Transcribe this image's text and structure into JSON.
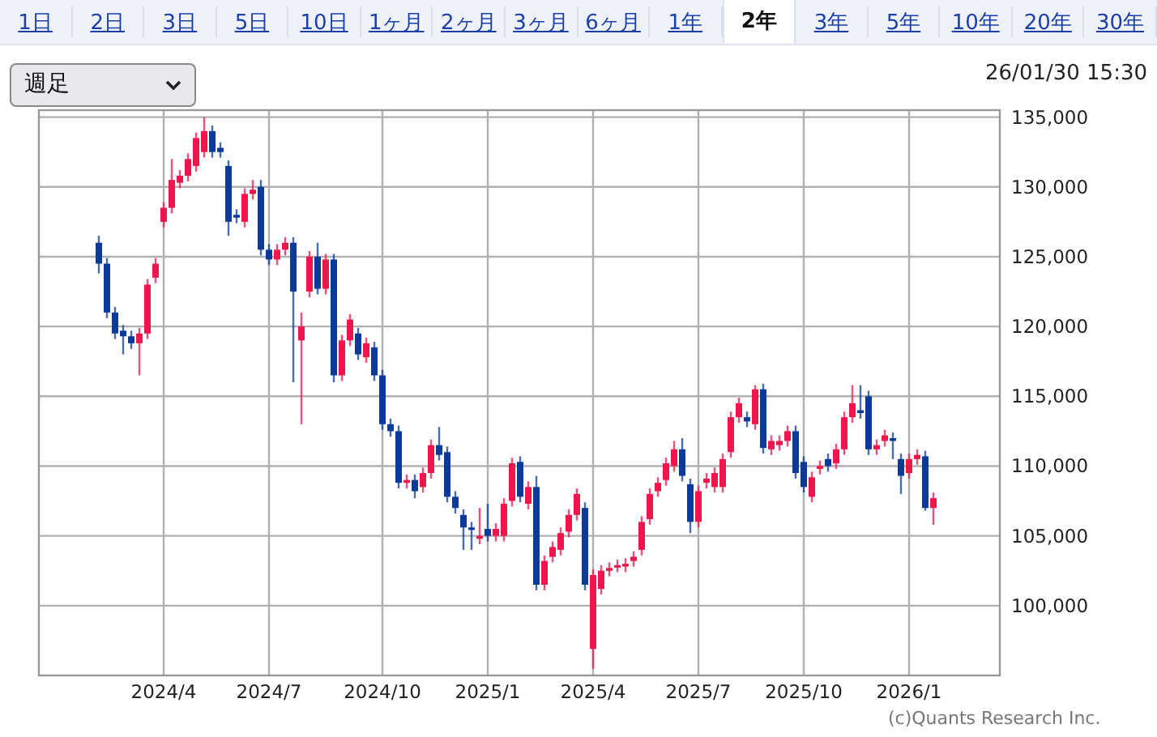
{
  "tabs": [
    {
      "label": "1日",
      "selected": false
    },
    {
      "label": "2日",
      "selected": false
    },
    {
      "label": "3日",
      "selected": false
    },
    {
      "label": "5日",
      "selected": false
    },
    {
      "label": "10日",
      "selected": false
    },
    {
      "label": "1ヶ月",
      "selected": false
    },
    {
      "label": "2ヶ月",
      "selected": false
    },
    {
      "label": "3ヶ月",
      "selected": false
    },
    {
      "label": "6ヶ月",
      "selected": false
    },
    {
      "label": "1年",
      "selected": false
    },
    {
      "label": "2年",
      "selected": true
    },
    {
      "label": "3年",
      "selected": false
    },
    {
      "label": "5年",
      "selected": false
    },
    {
      "label": "10年",
      "selected": false
    },
    {
      "label": "20年",
      "selected": false
    },
    {
      "label": "30年",
      "selected": false
    }
  ],
  "interval_select": {
    "value": "週足"
  },
  "timestamp": "26/01/30 15:30",
  "chart": {
    "chart_data": {
      "type": "candlestick",
      "grid": true,
      "ylim": [
        95000,
        135500
      ],
      "yticks": [
        {
          "value": 100000,
          "label": "100,000"
        },
        {
          "value": 105000,
          "label": "105,000"
        },
        {
          "value": 110000,
          "label": "110,000"
        },
        {
          "value": 115000,
          "label": "115,000"
        },
        {
          "value": 120000,
          "label": "120,000"
        },
        {
          "value": 125000,
          "label": "125,000"
        },
        {
          "value": 130000,
          "label": "130,000"
        },
        {
          "value": 135000,
          "label": "135,000"
        }
      ],
      "categories": [
        null,
        null,
        null,
        null,
        null,
        null,
        null,
        null,
        "2024/4",
        null,
        null,
        null,
        null,
        null,
        null,
        null,
        null,
        null,
        null,
        null,
        null,
        "2024/7",
        null,
        null,
        null,
        null,
        null,
        null,
        null,
        null,
        null,
        null,
        null,
        null,
        null,
        "2024/10",
        null,
        null,
        null,
        null,
        null,
        null,
        null,
        null,
        null,
        null,
        null,
        null,
        "2025/1",
        null,
        null,
        null,
        null,
        null,
        null,
        null,
        null,
        null,
        null,
        null,
        null,
        "2025/4",
        null,
        null,
        null,
        null,
        null,
        null,
        null,
        null,
        null,
        null,
        null,
        null,
        "2025/7",
        null,
        null,
        null,
        null,
        null,
        null,
        null,
        null,
        null,
        null,
        null,
        null,
        "2025/10",
        null,
        null,
        null,
        null,
        null,
        null,
        null,
        null,
        null,
        null,
        null,
        null,
        "2026/1",
        null,
        null,
        null
      ],
      "ohlc": [
        [
          126000,
          126500,
          123800,
          124500
        ],
        [
          124500,
          124900,
          120600,
          121000
        ],
        [
          121000,
          121400,
          119100,
          119500
        ],
        [
          119700,
          120100,
          118000,
          119300
        ],
        [
          119300,
          119700,
          118400,
          118800
        ],
        [
          118800,
          119900,
          116500,
          119500
        ],
        [
          119500,
          123400,
          119100,
          123000
        ],
        [
          123500,
          124900,
          123100,
          124500
        ],
        [
          127500,
          128900,
          127100,
          128500
        ],
        [
          128500,
          132000,
          128100,
          130500
        ],
        [
          130300,
          131200,
          129900,
          130800
        ],
        [
          130800,
          132400,
          130400,
          132000
        ],
        [
          131500,
          133900,
          131100,
          133500
        ],
        [
          132500,
          135000,
          132100,
          134000
        ],
        [
          134000,
          134400,
          132100,
          132500
        ],
        [
          132800,
          133200,
          132100,
          132500
        ],
        [
          131500,
          131900,
          126500,
          127500
        ],
        [
          128000,
          128400,
          127400,
          127800
        ],
        [
          127500,
          129900,
          127100,
          129500
        ],
        [
          129500,
          130500,
          129100,
          129800
        ],
        [
          130000,
          130500,
          125100,
          125500
        ],
        [
          125500,
          125900,
          124400,
          124800
        ],
        [
          124800,
          125900,
          124400,
          125500
        ],
        [
          125500,
          126400,
          125100,
          126000
        ],
        [
          126000,
          126400,
          116000,
          122500
        ],
        [
          119000,
          121000,
          113000,
          120000
        ],
        [
          122500,
          125400,
          122100,
          125000
        ],
        [
          125000,
          126000,
          122300,
          122700
        ],
        [
          122700,
          125200,
          122300,
          124800
        ],
        [
          124800,
          125200,
          116000,
          116500
        ],
        [
          116500,
          119400,
          116100,
          119000
        ],
        [
          119000,
          120900,
          118600,
          120500
        ],
        [
          119500,
          119900,
          117600,
          118000
        ],
        [
          117800,
          119200,
          117400,
          118800
        ],
        [
          118500,
          118900,
          116100,
          116500
        ],
        [
          116500,
          116900,
          112600,
          113000
        ],
        [
          113000,
          113400,
          112100,
          112500
        ],
        [
          112500,
          112900,
          108400,
          108800
        ],
        [
          108800,
          109400,
          108400,
          109000
        ],
        [
          109000,
          109400,
          107700,
          108200
        ],
        [
          108500,
          109900,
          108100,
          109500
        ],
        [
          109500,
          111900,
          109100,
          111500
        ],
        [
          111500,
          112800,
          110400,
          110800
        ],
        [
          111000,
          111400,
          107400,
          107800
        ],
        [
          107800,
          108200,
          106600,
          107000
        ],
        [
          106500,
          106900,
          104000,
          105600
        ],
        [
          105600,
          106000,
          104000,
          105500
        ],
        [
          104800,
          107000,
          104400,
          105000
        ],
        [
          105500,
          107300,
          104600,
          105000
        ],
        [
          105000,
          105900,
          104600,
          105500
        ],
        [
          105000,
          107700,
          104600,
          107300
        ],
        [
          107500,
          110600,
          107100,
          110200
        ],
        [
          110300,
          110700,
          107400,
          107800
        ],
        [
          107300,
          108900,
          106900,
          108500
        ],
        [
          108500,
          109300,
          101100,
          101500
        ],
        [
          101500,
          103600,
          101100,
          103200
        ],
        [
          103500,
          104600,
          103100,
          104200
        ],
        [
          104000,
          105600,
          103600,
          105200
        ],
        [
          105300,
          106900,
          104900,
          106500
        ],
        [
          106500,
          108400,
          106100,
          108000
        ],
        [
          107000,
          107400,
          101100,
          101500
        ],
        [
          96900,
          102600,
          95500,
          102200
        ],
        [
          101200,
          102900,
          100800,
          102500
        ],
        [
          102500,
          103100,
          102100,
          102700
        ],
        [
          102800,
          103300,
          102400,
          102900
        ],
        [
          102800,
          103400,
          102400,
          103000
        ],
        [
          103200,
          103900,
          102800,
          103500
        ],
        [
          104000,
          106400,
          103600,
          106000
        ],
        [
          106200,
          108400,
          105800,
          108000
        ],
        [
          108200,
          109200,
          107800,
          108800
        ],
        [
          109000,
          110600,
          108600,
          110200
        ],
        [
          110000,
          111800,
          109600,
          111200
        ],
        [
          111200,
          112000,
          108900,
          109300
        ],
        [
          108700,
          109100,
          105200,
          106000
        ],
        [
          106000,
          108600,
          105600,
          108200
        ],
        [
          108800,
          109500,
          108400,
          109100
        ],
        [
          108500,
          109900,
          108100,
          109500
        ],
        [
          108500,
          110900,
          108100,
          110500
        ],
        [
          111000,
          113900,
          110600,
          113500
        ],
        [
          113500,
          114900,
          113100,
          114500
        ],
        [
          113500,
          113900,
          112800,
          113200
        ],
        [
          113000,
          115800,
          112600,
          115500
        ],
        [
          115500,
          115900,
          110900,
          111300
        ],
        [
          111200,
          112200,
          110800,
          111800
        ],
        [
          111500,
          112200,
          111100,
          111800
        ],
        [
          111800,
          112900,
          111400,
          112500
        ],
        [
          112500,
          112900,
          109100,
          109500
        ],
        [
          110300,
          110700,
          108100,
          108500
        ],
        [
          107800,
          109600,
          107400,
          109200
        ],
        [
          109800,
          110400,
          109400,
          110000
        ],
        [
          110500,
          110900,
          109600,
          110000
        ],
        [
          110200,
          111600,
          109800,
          111200
        ],
        [
          111200,
          113900,
          110800,
          113500
        ],
        [
          113500,
          115800,
          113100,
          114500
        ],
        [
          114000,
          115800,
          113400,
          113800
        ],
        [
          115000,
          115400,
          110800,
          111200
        ],
        [
          111200,
          111900,
          110800,
          111500
        ],
        [
          111800,
          112600,
          111400,
          112200
        ],
        [
          112000,
          112400,
          110500,
          111800
        ],
        [
          110500,
          110900,
          108000,
          109300
        ],
        [
          109500,
          110900,
          109100,
          110500
        ],
        [
          110500,
          111200,
          110100,
          110800
        ],
        [
          110700,
          111100,
          106800,
          107000
        ],
        [
          107000,
          108100,
          105800,
          107700
        ]
      ]
    },
    "credit": "(c)Quants Research Inc."
  }
}
